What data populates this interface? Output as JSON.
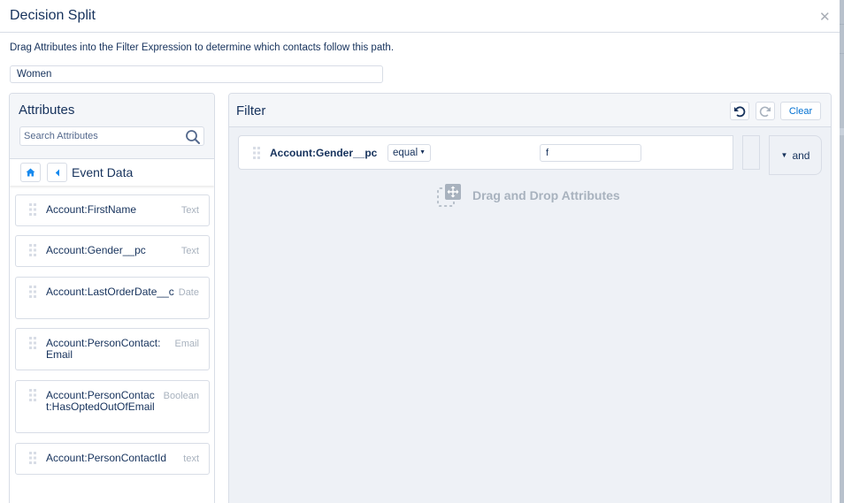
{
  "modal": {
    "title": "Decision Split",
    "close_icon": "close-icon",
    "instructions": "Drag Attributes into the Filter Expression to determine which contacts follow this path.",
    "path_name_value": "Women"
  },
  "attributes": {
    "title": "Attributes",
    "search_placeholder": "Search Attributes",
    "nav": {
      "home_icon": "home-icon",
      "back_icon": "back-icon",
      "current": "Event Data"
    },
    "items": [
      {
        "name": "Account:FirstName",
        "type": "Text"
      },
      {
        "name": "Account:Gender__pc",
        "type": "Text"
      },
      {
        "name": "Account:LastOrderDate__c",
        "type": "Date"
      },
      {
        "name": "Account:PersonContact:Email",
        "type": "Email"
      },
      {
        "name": "Account:PersonContact:HasOptedOutOfEmail",
        "type": "Boolean"
      },
      {
        "name": "Account:PersonContactId",
        "type": "text"
      }
    ]
  },
  "filter": {
    "title": "Filter",
    "undo_icon": "undo-icon",
    "redo_icon": "redo-icon",
    "clear_label": "Clear",
    "condition": {
      "field": "Account:Gender__pc",
      "operator": "equal",
      "value": "f"
    },
    "logic_operator": "and",
    "drop_hint": "Drag and Drop Attributes"
  }
}
